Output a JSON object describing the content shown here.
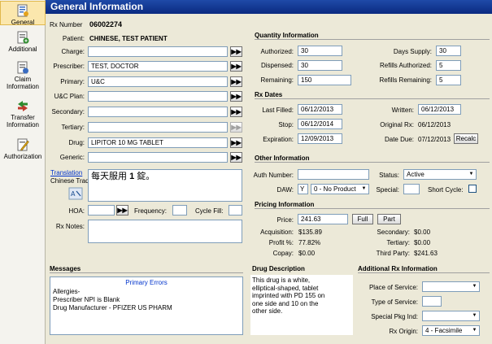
{
  "nav": {
    "items": [
      {
        "label": "General",
        "active": true
      },
      {
        "label": "Additional"
      },
      {
        "label": "Claim Information"
      },
      {
        "label": "Transfer Information"
      },
      {
        "label": "Authorization"
      }
    ]
  },
  "header": {
    "title": "General Information"
  },
  "rx": {
    "label": "Rx Number",
    "value": "06002274"
  },
  "patient": {
    "label": "Patient:",
    "value": "CHINESE, TEST PATIENT"
  },
  "left_fields": {
    "charge": {
      "label": "Charge:",
      "value": ""
    },
    "prescriber": {
      "label": "Prescriber:",
      "value": "TEST, DOCTOR"
    },
    "primary": {
      "label": "Primary:",
      "value": "U&C"
    },
    "uc_plan": {
      "label": "U&C Plan:",
      "value": ""
    },
    "secondary": {
      "label": "Secondary:",
      "value": ""
    },
    "tertiary": {
      "label": "Tertiary:",
      "value": ""
    },
    "drug": {
      "label": "Drug:",
      "value": "LIPITOR 10 MG TABLET"
    },
    "generic": {
      "label": "Generic:",
      "value": ""
    }
  },
  "translation": {
    "link": "Translation",
    "language": "Chinese Trad",
    "text_pre": "每天服用 ",
    "text_bold": "1",
    "text_post": " 錠。"
  },
  "hoa": {
    "label": "HOA:",
    "value": "",
    "frequency_label": "Frequency:",
    "frequency": "",
    "cycle_label": "Cycle Fill:",
    "cycle": ""
  },
  "rx_notes": {
    "label": "Rx Notes:",
    "value": ""
  },
  "quantity": {
    "title": "Quantity Information",
    "authorized_label": "Authorized:",
    "authorized": "30",
    "dispensed_label": "Dispensed:",
    "dispensed": "30",
    "remaining_label": "Remaining:",
    "remaining": "150",
    "days_supply_label": "Days Supply:",
    "days_supply": "30",
    "refills_auth_label": "Refills Authorized:",
    "refills_auth": "5",
    "refills_rem_label": "Refills Remaining:",
    "refills_rem": "5"
  },
  "dates": {
    "title": "Rx Dates",
    "last_filled_label": "Last Filled:",
    "last_filled": "06/12/2013",
    "stop_label": "Stop:",
    "stop": "06/12/2014",
    "expiration_label": "Expiration:",
    "expiration": "12/09/2013",
    "written_label": "Written:",
    "written": "06/12/2013",
    "original_label": "Original Rx:",
    "original": "06/12/2013",
    "due_label": "Date Due:",
    "due": "07/12/2013",
    "recalc": "Recalc"
  },
  "other": {
    "title": "Other Information",
    "auth_label": "Auth Number:",
    "auth": "",
    "daw_label": "DAW:",
    "daw_code": "Y",
    "daw_value": "0 - No Product",
    "status_label": "Status:",
    "status": "Active",
    "special_label": "Special:",
    "special": "",
    "short_cycle_label": "Short Cycle:"
  },
  "pricing": {
    "title": "Pricing Information",
    "price_label": "Price:",
    "price": "241.63",
    "full_btn": "Full",
    "part_btn": "Part",
    "acquisition_label": "Acquisition:",
    "acquisition": "$135.89",
    "profit_label": "Profit %:",
    "profit": "77.82%",
    "copay_label": "Copay:",
    "copay": "$0.00",
    "secondary_label": "Secondary:",
    "secondary": "$0.00",
    "tertiary_label": "Tertiary:",
    "tertiary": "$0.00",
    "third_party_label": "Third Party:",
    "third_party": "$241.63"
  },
  "messages": {
    "title": "Messages",
    "heading": "Primary Errors",
    "lines": [
      "Allergies-",
      "Prescriber NPI is Blank",
      "Drug Manufacturer - PFIZER US PHARM"
    ]
  },
  "drug_description": {
    "title": "Drug Description",
    "lines": [
      "This drug is a white,",
      "elliptical-shaped, tablet",
      "imprinted with PD 155 on",
      "one side and 10 on the",
      "other side."
    ]
  },
  "additional_rx": {
    "title": "Additional Rx Information",
    "place_label": "Place of Service:",
    "place": "",
    "type_label": "Type of Service:",
    "type": "",
    "pkg_label": "Special Pkg Ind:",
    "pkg": "",
    "origin_label": "Rx Origin:",
    "origin": "4 - Facsimile"
  },
  "colors": {
    "header": "#0a2a80",
    "accent": "#0033cc",
    "panel": "#ece9d8"
  }
}
